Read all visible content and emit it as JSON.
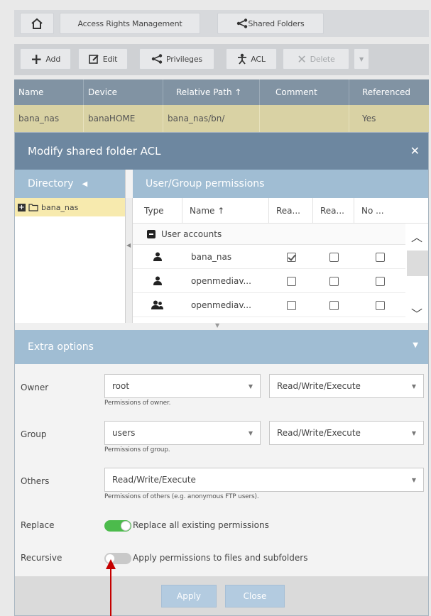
{
  "breadcrumb": {
    "items": [
      "Access Rights Management",
      "Shared Folders"
    ]
  },
  "toolbar": {
    "add": "Add",
    "edit": "Edit",
    "privileges": "Privileges",
    "acl": "ACL",
    "delete": "Delete"
  },
  "grid": {
    "columns": [
      "Name",
      "Device",
      "Relative Path ↑",
      "Comment",
      "Referenced"
    ],
    "rows": [
      [
        "bana_nas",
        "banaHOME",
        "bana_nas/bn/",
        "",
        "Yes"
      ]
    ]
  },
  "dialog": {
    "title": "Modify shared folder ACL",
    "directory": {
      "title": "Directory",
      "item": "bana_nas"
    },
    "permissions": {
      "title": "User/Group permissions",
      "columns": [
        "Type",
        "Name ↑",
        "Rea...",
        "Rea...",
        "No ..."
      ],
      "group": "User accounts",
      "rows": [
        {
          "name": "bana_nas",
          "values": [
            true,
            false,
            false
          ]
        },
        {
          "name": "openmediav...",
          "values": [
            false,
            false,
            false
          ]
        },
        {
          "name": "openmediav...",
          "values": [
            false,
            false,
            false
          ]
        }
      ]
    },
    "extra": {
      "title": "Extra options",
      "owner": {
        "label": "Owner",
        "user": "root",
        "perm": "Read/Write/Execute",
        "hint": "Permissions of owner."
      },
      "group": {
        "label": "Group",
        "user": "users",
        "perm": "Read/Write/Execute",
        "hint": "Permissions of group."
      },
      "others": {
        "label": "Others",
        "perm": "Read/Write/Execute",
        "hint": "Permissions of others (e.g. anonymous FTP users)."
      },
      "replace": {
        "label": "Replace",
        "text": "Replace all existing permissions",
        "on": true
      },
      "recursive": {
        "label": "Recursive",
        "text": "Apply permissions to files and subfolders",
        "on": false
      }
    },
    "buttons": {
      "apply": "Apply",
      "close": "Close"
    }
  },
  "colors": {
    "accent": "#6d87a0",
    "toggle_on": "#4cbb4c",
    "annotation": "#c50000"
  }
}
